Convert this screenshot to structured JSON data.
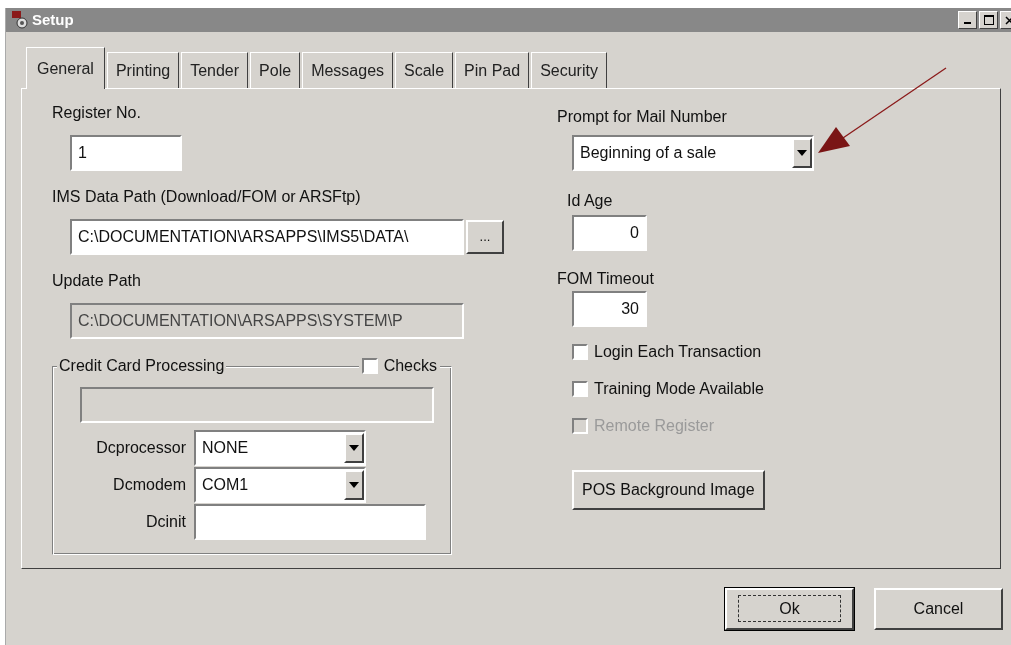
{
  "window": {
    "title": "Setup"
  },
  "tabs": [
    {
      "label": "General",
      "selected": true
    },
    {
      "label": "Printing",
      "selected": false
    },
    {
      "label": "Tender",
      "selected": false
    },
    {
      "label": "Pole",
      "selected": false
    },
    {
      "label": "Messages",
      "selected": false
    },
    {
      "label": "Scale",
      "selected": false
    },
    {
      "label": "Pin Pad",
      "selected": false
    },
    {
      "label": "Security",
      "selected": false
    }
  ],
  "register_no": {
    "label": "Register No.",
    "value": "1"
  },
  "ims_data_path": {
    "label": "IMS Data Path (Download/FOM or ARSFtp)",
    "value": "C:\\DOCUMENTATION\\ARSAPPS\\IMS5\\DATA\\",
    "browse_button": "...",
    "disabled": false
  },
  "update_path": {
    "label": "Update Path",
    "value": "C:\\DOCUMENTATION\\ARSAPPS\\SYSTEM\\P",
    "disabled": true
  },
  "credit_card_processing": {
    "title": "Credit Card Processing",
    "checks": {
      "label": "Checks",
      "checked": false
    },
    "fields": [
      {
        "label": "Dcprocessor",
        "kind": "combo",
        "value": "NONE"
      },
      {
        "label": "Dcmodem",
        "kind": "combo",
        "value": "COM1"
      },
      {
        "label": "Dcinit",
        "kind": "text"
      }
    ]
  },
  "prompt_for_mail_number": {
    "label": "Prompt for Mail Number",
    "value": "Beginning of a sale"
  },
  "id_age": {
    "label": "Id Age",
    "value": "0"
  },
  "fom_timeout": {
    "label": "FOM Timeout",
    "value": "30"
  },
  "options": [
    {
      "label": "Login Each Transaction",
      "checked": false,
      "disabled": false
    },
    {
      "label": "Training Mode Available",
      "checked": false,
      "disabled": false
    },
    {
      "label": "Remote Register",
      "checked": false,
      "disabled": true
    }
  ],
  "pos_background_button": "POS Background Image",
  "buttons": [
    {
      "label": "Ok",
      "default": true
    },
    {
      "label": "Cancel",
      "default": false
    }
  ]
}
